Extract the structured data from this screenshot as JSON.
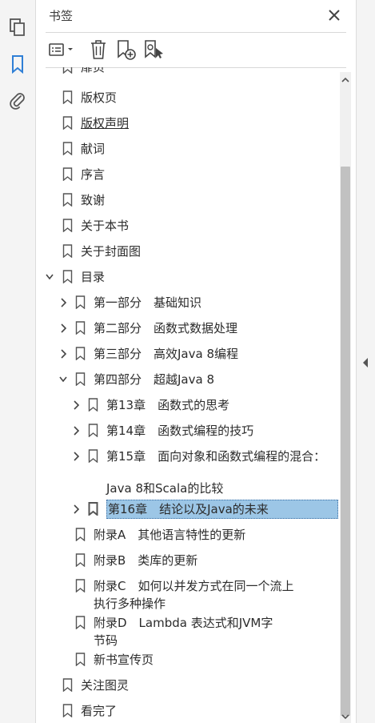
{
  "panel": {
    "title": "书签"
  },
  "toolbar": {
    "options_icon": "list-options-icon",
    "delete_icon": "trash-icon",
    "new_bookmark_icon": "new-bookmark-icon",
    "bookmark_from_selection_icon": "bookmark-cursor-icon"
  },
  "sidebar": {
    "items": [
      {
        "name": "pages-icon"
      },
      {
        "name": "bookmarks-icon",
        "active": true
      },
      {
        "name": "attachments-icon"
      }
    ]
  },
  "bookmarks": [
    {
      "label": "扉页"
    },
    {
      "label": "版权页"
    },
    {
      "label": "版权声明"
    },
    {
      "label": "献词"
    },
    {
      "label": "序言"
    },
    {
      "label": "致谢"
    },
    {
      "label": "关于本书"
    },
    {
      "label": "关于封面图"
    },
    {
      "label": "目录",
      "expanded": true
    },
    {
      "label": "第一部分　基础知识",
      "collapsed": true
    },
    {
      "label": "第二部分　函数式数据处理",
      "collapsed": true
    },
    {
      "label": "第三部分　高效Java 8编程",
      "collapsed": true
    },
    {
      "label": "第四部分　超越Java 8",
      "expanded": true
    },
    {
      "label": "第13章　函数式的思考",
      "collapsed": true
    },
    {
      "label": "第14章　函数式编程的技巧",
      "collapsed": true
    },
    {
      "label": "第15章　面向对象和函数式编程的混合：",
      "collapsed": true
    },
    {
      "label": "Java 8和Scala的比较"
    },
    {
      "label": "第16章　结论以及Java的未来",
      "collapsed": true,
      "selected": true
    },
    {
      "label": "附录A　其他语言特性的更新"
    },
    {
      "label": "附录B　类库的更新"
    },
    {
      "label": "附录C　如何以并发方式在同一个流上"
    },
    {
      "label": "执行多种操作"
    },
    {
      "label": "附录D　Lambda 表达式和JVM字"
    },
    {
      "label": "节码"
    },
    {
      "label": "新书宣传页"
    },
    {
      "label": "关注图灵"
    },
    {
      "label": "看完了"
    }
  ],
  "colors": {
    "accent": "#2f7fd6",
    "selection": "#9cc6e6"
  }
}
